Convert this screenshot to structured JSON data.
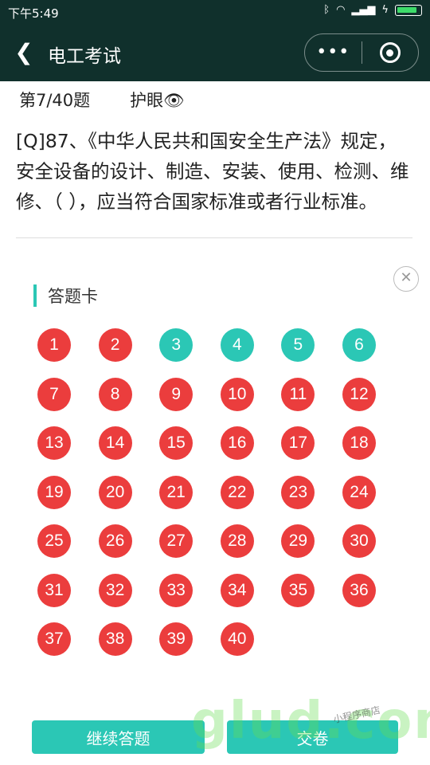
{
  "status_bar": {
    "time": "下午5:49",
    "icons": [
      "bluetooth-icon",
      "wifi-icon",
      "signal-icon",
      "charging-icon",
      "battery-icon"
    ]
  },
  "nav": {
    "title": "电工考试",
    "back_icon": "chevron-left-icon",
    "more_icon": "more-dots-icon",
    "close_icon": "target-close-icon"
  },
  "question": {
    "progress": "第7/40题",
    "eye_mode": "护眼",
    "text": "[Q]87、《中华人民共和国安全生产法》规定，安全设备的设计、制造、安装、使用、检测、维修、（ ），应当符合国家标准或者行业标准。"
  },
  "answer_card": {
    "title": "答题卡",
    "close_icon": "close-circle-icon",
    "items": [
      {
        "label": "1",
        "status": "wrong"
      },
      {
        "label": "2",
        "status": "wrong"
      },
      {
        "label": "3",
        "status": "right"
      },
      {
        "label": "4",
        "status": "right"
      },
      {
        "label": "5",
        "status": "right"
      },
      {
        "label": "6",
        "status": "right"
      },
      {
        "label": "7",
        "status": "wrong"
      },
      {
        "label": "8",
        "status": "wrong"
      },
      {
        "label": "9",
        "status": "wrong"
      },
      {
        "label": "10",
        "status": "wrong"
      },
      {
        "label": "11",
        "status": "wrong"
      },
      {
        "label": "12",
        "status": "wrong"
      },
      {
        "label": "13",
        "status": "wrong"
      },
      {
        "label": "14",
        "status": "wrong"
      },
      {
        "label": "15",
        "status": "wrong"
      },
      {
        "label": "16",
        "status": "wrong"
      },
      {
        "label": "17",
        "status": "wrong"
      },
      {
        "label": "18",
        "status": "wrong"
      },
      {
        "label": "19",
        "status": "wrong"
      },
      {
        "label": "20",
        "status": "wrong"
      },
      {
        "label": "21",
        "status": "wrong"
      },
      {
        "label": "22",
        "status": "wrong"
      },
      {
        "label": "23",
        "status": "wrong"
      },
      {
        "label": "24",
        "status": "wrong"
      },
      {
        "label": "25",
        "status": "wrong"
      },
      {
        "label": "26",
        "status": "wrong"
      },
      {
        "label": "27",
        "status": "wrong"
      },
      {
        "label": "28",
        "status": "wrong"
      },
      {
        "label": "29",
        "status": "wrong"
      },
      {
        "label": "30",
        "status": "wrong"
      },
      {
        "label": "31",
        "status": "wrong"
      },
      {
        "label": "32",
        "status": "wrong"
      },
      {
        "label": "33",
        "status": "wrong"
      },
      {
        "label": "34",
        "status": "wrong"
      },
      {
        "label": "35",
        "status": "wrong"
      },
      {
        "label": "36",
        "status": "wrong"
      },
      {
        "label": "37",
        "status": "wrong"
      },
      {
        "label": "38",
        "status": "wrong"
      },
      {
        "label": "39",
        "status": "wrong"
      },
      {
        "label": "40",
        "status": "wrong"
      }
    ],
    "colors": {
      "wrong": "#eb3d3d",
      "right": "#2bc7b5"
    }
  },
  "buttons": {
    "continue": "继续答题",
    "submit": "交卷"
  },
  "watermark": {
    "main": "glud.com",
    "small": "小程序商店"
  }
}
